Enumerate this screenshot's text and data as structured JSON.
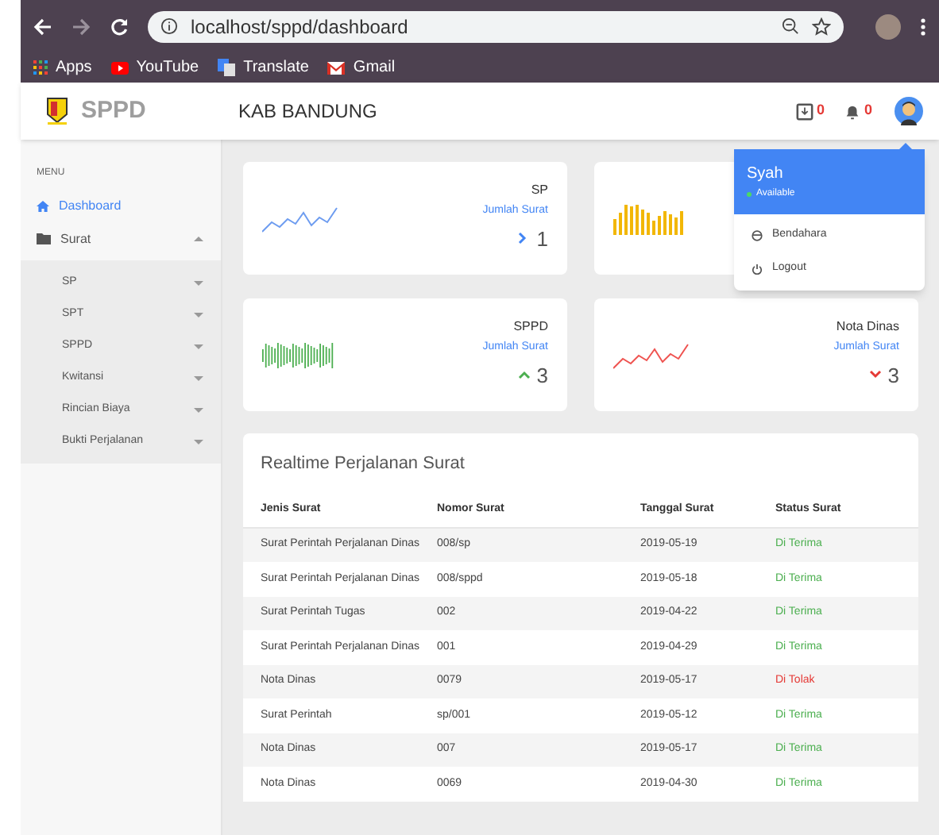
{
  "browser": {
    "url": "localhost/sppd/dashboard",
    "bookmarks": [
      {
        "label": "Apps",
        "kind": "apps"
      },
      {
        "label": "YouTube",
        "kind": "youtube"
      },
      {
        "label": "Translate",
        "kind": "translate"
      },
      {
        "label": "Gmail",
        "kind": "gmail"
      }
    ]
  },
  "header": {
    "logo": "SPPD",
    "title": "KAB BANDUNG",
    "inbox_count": "0",
    "notification_count": "0"
  },
  "sidebar": {
    "heading": "MENU",
    "items": [
      {
        "label": "Dashboard",
        "selected": true
      },
      {
        "label": "Surat",
        "selected": false,
        "expanded": true,
        "children": [
          {
            "label": "SP",
            "expanded": false
          },
          {
            "label": "SPT",
            "expanded": false
          },
          {
            "label": "SPPD",
            "expanded": false
          },
          {
            "label": "Kwitansi",
            "expanded": false
          },
          {
            "label": "Rincian Biaya",
            "expanded": false
          },
          {
            "label": "Bukti Perjalanan",
            "expanded": false
          }
        ]
      }
    ]
  },
  "stat_cards": [
    {
      "title": "SP",
      "subtitle": "Jumlah Surat",
      "value": "1",
      "kind": "line",
      "color": "#6d9cf0"
    },
    {
      "kind": "bars",
      "color": "#f2b705"
    },
    {
      "title": "SPPD",
      "subtitle": "Jumlah Surat",
      "value": "3",
      "kind": "ticks",
      "color": "#4caf50"
    },
    {
      "title": "Nota Dinas",
      "subtitle": "Jumlah Surat",
      "value": "3",
      "kind": "line",
      "color": "#ef5350"
    }
  ],
  "table": {
    "title": "Realtime Perjalanan Surat",
    "columns": [
      "Jenis Surat",
      "Nomor Surat",
      "Tanggal Surat",
      "Status Surat"
    ],
    "rows": [
      {
        "cells": [
          "Surat Perintah Perjalanan Dinas",
          "008/sp",
          "2019-05-19"
        ],
        "status": "Di Terima",
        "color": "#4caf50"
      },
      {
        "cells": [
          "Surat Perintah Perjalanan Dinas",
          "008/sppd",
          "2019-05-18"
        ],
        "status": "Di Terima",
        "color": "#4caf50"
      },
      {
        "cells": [
          "Surat Perintah Tugas",
          "002",
          "2019-04-22"
        ],
        "status": "Di Terima",
        "color": "#4caf50"
      },
      {
        "cells": [
          "Surat Perintah Perjalanan Dinas",
          "001",
          "2019-04-29"
        ],
        "status": "Di Terima",
        "color": "#4caf50"
      },
      {
        "cells": [
          "Nota Dinas",
          "0079",
          "2019-05-17"
        ],
        "status": "Di Tolak",
        "color": "#e53935"
      },
      {
        "cells": [
          "Surat Perintah",
          "sp/001",
          "2019-05-12"
        ],
        "status": "Di Terima",
        "color": "#4caf50"
      },
      {
        "cells": [
          "Nota Dinas",
          "007",
          "2019-05-17"
        ],
        "status": "Di Terima",
        "color": "#4caf50"
      },
      {
        "cells": [
          "Nota Dinas",
          "0069",
          "2019-04-30"
        ],
        "status": "Di Terima",
        "color": "#4caf50"
      }
    ]
  },
  "user_menu": {
    "name": "Syah",
    "status": "Available",
    "items": [
      "Bendahara",
      "Logout"
    ]
  }
}
